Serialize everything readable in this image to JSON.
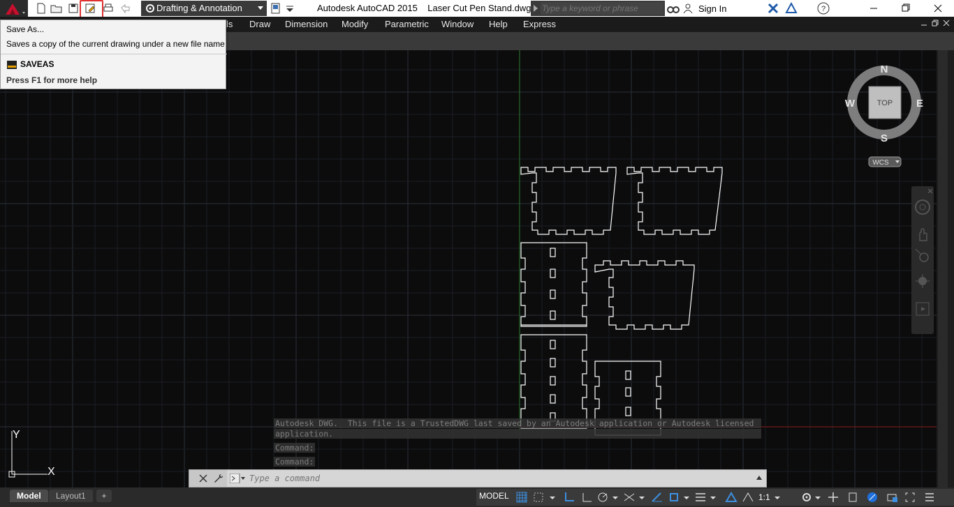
{
  "titlebar": {
    "app_name": "Autodesk AutoCAD 2015",
    "file_name": "Laser Cut Pen Stand.dwg",
    "workspace": "Drafting & Annotation",
    "search_placeholder": "Type a keyword or phrase",
    "signin_label": "Sign In",
    "qat_icons": [
      "new-icon",
      "open-icon",
      "save-icon",
      "saveas-icon",
      "plot-icon",
      "undo-icon"
    ]
  },
  "menubar": {
    "items": [
      {
        "label": "ls"
      },
      {
        "label": "Draw"
      },
      {
        "label": "Dimension"
      },
      {
        "label": "Modify"
      },
      {
        "label": "Parametric"
      },
      {
        "label": "Window"
      },
      {
        "label": "Help"
      },
      {
        "label": "Express"
      }
    ]
  },
  "tooltip": {
    "title": "Save As...",
    "description": "Saves a copy of the current drawing under a new file name",
    "command": "SAVEAS",
    "help": "Press F1 for more help"
  },
  "viewcube": {
    "north": "N",
    "south": "S",
    "east": "E",
    "west": "W",
    "face": "TOP",
    "ucs": "WCS"
  },
  "ucs_icon": {
    "x_label": "X",
    "y_label": "Y"
  },
  "command_history": [
    "Autodesk DWG.  This file is a TrustedDWG last saved by an Autodesk application or Autodesk licensed",
    "application.",
    "Command:",
    "Command:"
  ],
  "command_input": {
    "placeholder": "Type a command"
  },
  "layout_tabs": [
    {
      "label": "Model",
      "active": true
    },
    {
      "label": "Layout1",
      "active": false
    },
    {
      "label": "+",
      "active": false
    }
  ],
  "statusbar": {
    "model_label": "MODEL",
    "scale_label": "1:1"
  },
  "colors": {
    "canvas_bg": "#0c0c0c",
    "grid_minor": "#1a1e26",
    "grid_major": "#2a2f3a",
    "y_axis": "#2e7d32",
    "x_axis": "#8b1a1a",
    "highlight": "#e03030"
  }
}
